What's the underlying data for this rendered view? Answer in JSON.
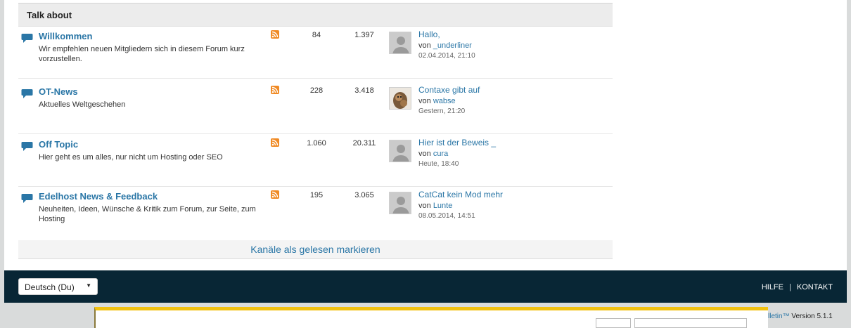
{
  "section": {
    "title": "Talk about"
  },
  "forums": [
    {
      "title": "Willkommen",
      "description": "Wir empfehlen neuen Mitgliedern sich in diesem Forum kurz vorzustellen.",
      "topics": "84",
      "posts": "1.397",
      "last_post": {
        "title": "Hallo,",
        "by_prefix": "von",
        "user": "_underliner",
        "date": "02.04.2014, 21:10",
        "avatar": "default"
      }
    },
    {
      "title": "OT-News",
      "description": "Aktuelles Weltgeschehen",
      "topics": "228",
      "posts": "3.418",
      "last_post": {
        "title": "Contaxe gibt auf",
        "by_prefix": "von",
        "user": "wabse",
        "date": "Gestern, 21:20",
        "avatar": "photo"
      }
    },
    {
      "title": "Off Topic",
      "description": "Hier geht es um alles, nur nicht um Hosting oder SEO",
      "topics": "1.060",
      "posts": "20.311",
      "last_post": {
        "title": "Hier ist der Beweis _",
        "by_prefix": "von",
        "user": "cura",
        "date": "Heute, 18:40",
        "avatar": "default"
      }
    },
    {
      "title": "Edelhost News & Feedback",
      "description": "Neuheiten, Ideen, Wünsche & Kritik zum Forum, zur Seite, zum Hosting",
      "topics": "195",
      "posts": "3.065",
      "last_post": {
        "title": "CatCat kein Mod mehr",
        "by_prefix": "von",
        "user": "Lunte",
        "date": "08.05.2014, 14:51",
        "avatar": "default"
      }
    }
  ],
  "mark_read": "Kanäle als gelesen markieren",
  "footer": {
    "language": "Deutsch (Du)",
    "links": [
      "HILFE",
      "KONTAKT"
    ],
    "separator": "|"
  },
  "version": {
    "brand": "lletin™",
    "text": " Version 5.1.1"
  },
  "icons": {
    "forum": "speech-bubble-icon",
    "rss": "rss-icon",
    "avatar": "user-avatar-icon",
    "dropdown": "caret-down-icon"
  },
  "colors": {
    "link": "#2a76a6",
    "footer": "#082635",
    "rss": "#f08a24",
    "header_bg": "#ececec"
  }
}
